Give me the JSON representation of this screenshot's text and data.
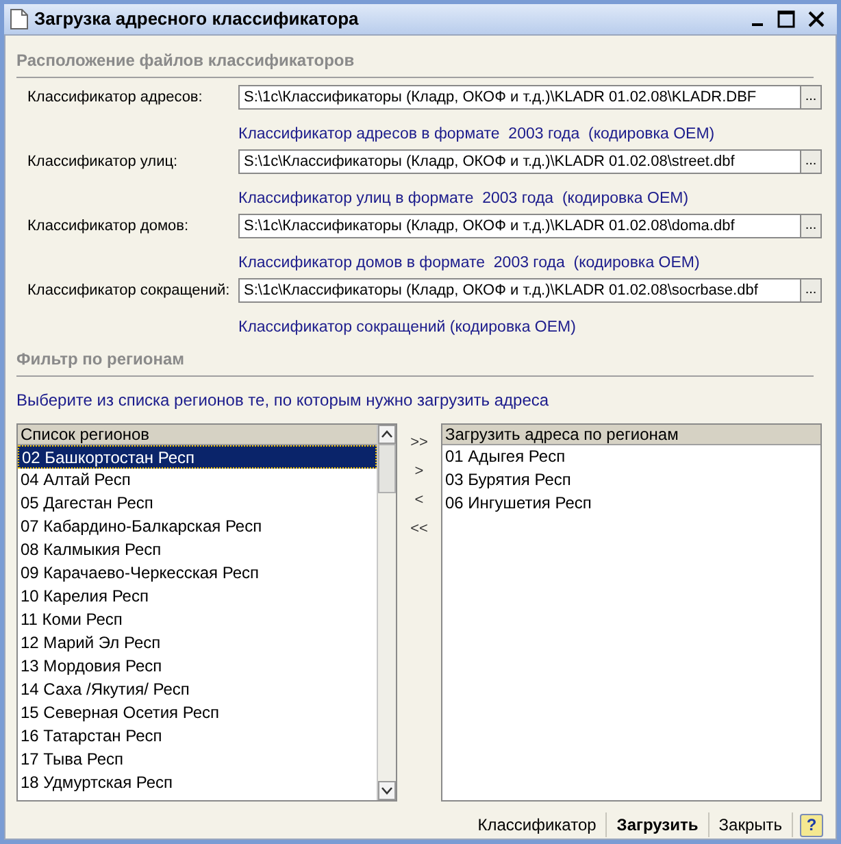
{
  "window": {
    "title": "Загрузка адресного классификатора"
  },
  "files_section": {
    "title": "Расположение файлов классификаторов",
    "rows": [
      {
        "label": "Классификатор адресов:",
        "value": "S:\\1c\\Классификаторы (Кладр, ОКОФ и т.д.)\\KLADR 01.02.08\\KLADR.DBF",
        "button": "...",
        "hint": "Классификатор адресов в формате  2003 года  (кодировка OEM)"
      },
      {
        "label": "Классификатор улиц:",
        "value": "S:\\1c\\Классификаторы (Кладр, ОКОФ и т.д.)\\KLADR 01.02.08\\street.dbf",
        "button": "...",
        "hint": "Классификатор улиц в формате  2003 года  (кодировка OEM)"
      },
      {
        "label": "Классификатор домов:",
        "value": "S:\\1c\\Классификаторы (Кладр, ОКОФ и т.д.)\\KLADR 01.02.08\\doma.dbf",
        "button": "...",
        "hint": "Классификатор домов в формате  2003 года  (кодировка OEM)"
      },
      {
        "label": "Классификатор сокращений:",
        "value": "S:\\1c\\Классификаторы (Кладр, ОКОФ и т.д.)\\KLADR 01.02.08\\socrbase.dbf",
        "button": "...",
        "hint": "Классификатор сокращений (кодировка OEM)"
      }
    ]
  },
  "filter_section": {
    "title": "Фильтр по регионам",
    "instruction": "Выберите из списка регионов те, по которым нужно загрузить адреса",
    "regions_list": {
      "header": "Список регионов",
      "items": [
        {
          "text": "02 Башкортостан Респ",
          "selected": true
        },
        {
          "text": "04 Алтай Респ",
          "selected": false
        },
        {
          "text": "05 Дагестан Респ",
          "selected": false
        },
        {
          "text": "07 Кабардино-Балкарская Респ",
          "selected": false
        },
        {
          "text": "08 Калмыкия Респ",
          "selected": false
        },
        {
          "text": "09 Карачаево-Черкесская Респ",
          "selected": false
        },
        {
          "text": "10 Карелия Респ",
          "selected": false
        },
        {
          "text": "11 Коми Респ",
          "selected": false
        },
        {
          "text": "12 Марий Эл Респ",
          "selected": false
        },
        {
          "text": "13 Мордовия Респ",
          "selected": false
        },
        {
          "text": "14 Саха /Якутия/ Респ",
          "selected": false
        },
        {
          "text": "15 Северная Осетия Респ",
          "selected": false
        },
        {
          "text": "16 Татарстан Респ",
          "selected": false
        },
        {
          "text": "17 Тыва Респ",
          "selected": false
        },
        {
          "text": "18 Удмуртская Респ",
          "selected": false
        }
      ]
    },
    "move_buttons": [
      ">>",
      ">",
      "<",
      "<<"
    ],
    "load_list": {
      "header": "Загрузить адреса по регионам",
      "items": [
        {
          "text": "01 Адыгея Респ",
          "selected": false
        },
        {
          "text": "03 Бурятия Респ",
          "selected": false
        },
        {
          "text": "06 Ингушетия Респ",
          "selected": false
        }
      ]
    }
  },
  "footer_buttons": [
    {
      "label": "Классификатор",
      "kind": "normal"
    },
    {
      "label": "Загрузить",
      "kind": "default"
    },
    {
      "label": "Закрыть",
      "kind": "normal"
    },
    {
      "label": "?",
      "kind": "help"
    }
  ]
}
